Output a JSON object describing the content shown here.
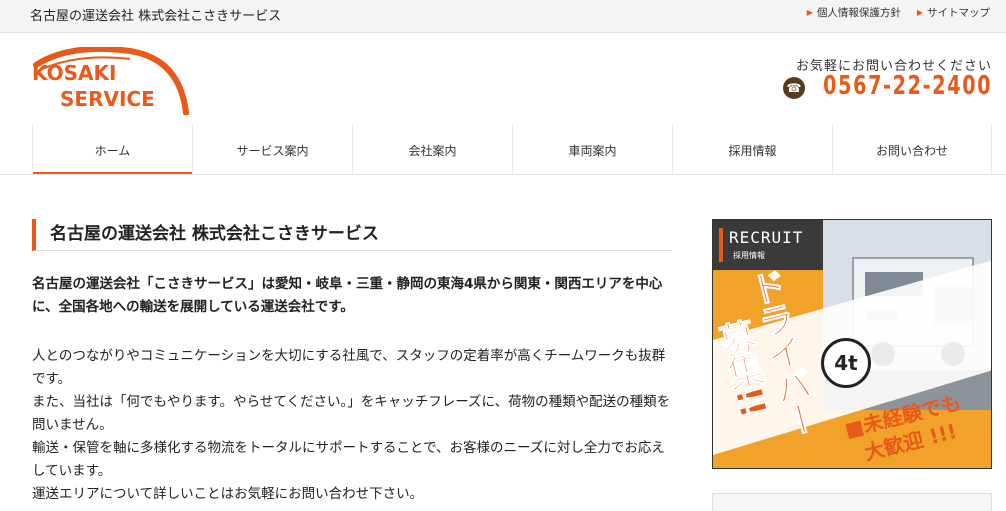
{
  "topbar": {
    "site_tag": "名古屋の運送会社 株式会社こさきサービス",
    "links": [
      {
        "label": "個人情報保護方針"
      },
      {
        "label": "サイトマップ"
      }
    ]
  },
  "header": {
    "logo_line1": "KOSAKI",
    "logo_line2": "SERVICE",
    "contact_caption": "お気軽にお問い合わせください",
    "phone": "0567-22-2400"
  },
  "nav": {
    "items": [
      {
        "label": "ホーム"
      },
      {
        "label": "サービス案内"
      },
      {
        "label": "会社案内"
      },
      {
        "label": "車両案内"
      },
      {
        "label": "採用情報"
      },
      {
        "label": "お問い合わせ"
      }
    ]
  },
  "main": {
    "heading": "名古屋の運送会社 株式会社こさきサービス",
    "lead": "名古屋の運送会社「こさきサービス」は愛知・岐阜・三重・静岡の東海4県から関東・関西エリアを中心に、全国各地への輸送を展開している運送会社です。",
    "paragraphs": [
      "人とのつながりやコミュニケーションを大切にする社風で、スタッフの定着率が高くチームワークも抜群です。",
      "また、当社は「何でもやります。やらせてください。」をキャッチフレーズに、荷物の種類や配送の種類を問いません。",
      "輸送・保管を軸に多様化する物流をトータルにサポートすることで、お客様のニーズに対し全力でお応えしています。",
      "運送エリアについて詳しいことはお気軽にお問い合わせ下さい。"
    ]
  },
  "banner": {
    "recruit": "RECRUIT",
    "recruit_sub": "採用情報",
    "headline": "ドライバー",
    "headline2": "募集!!",
    "badge": "4t",
    "tag1": "■未経験でも",
    "tag2": "大歓迎 !!!"
  },
  "colors": {
    "accent": "#e8591a",
    "banner_orange": "#f0a22a"
  }
}
